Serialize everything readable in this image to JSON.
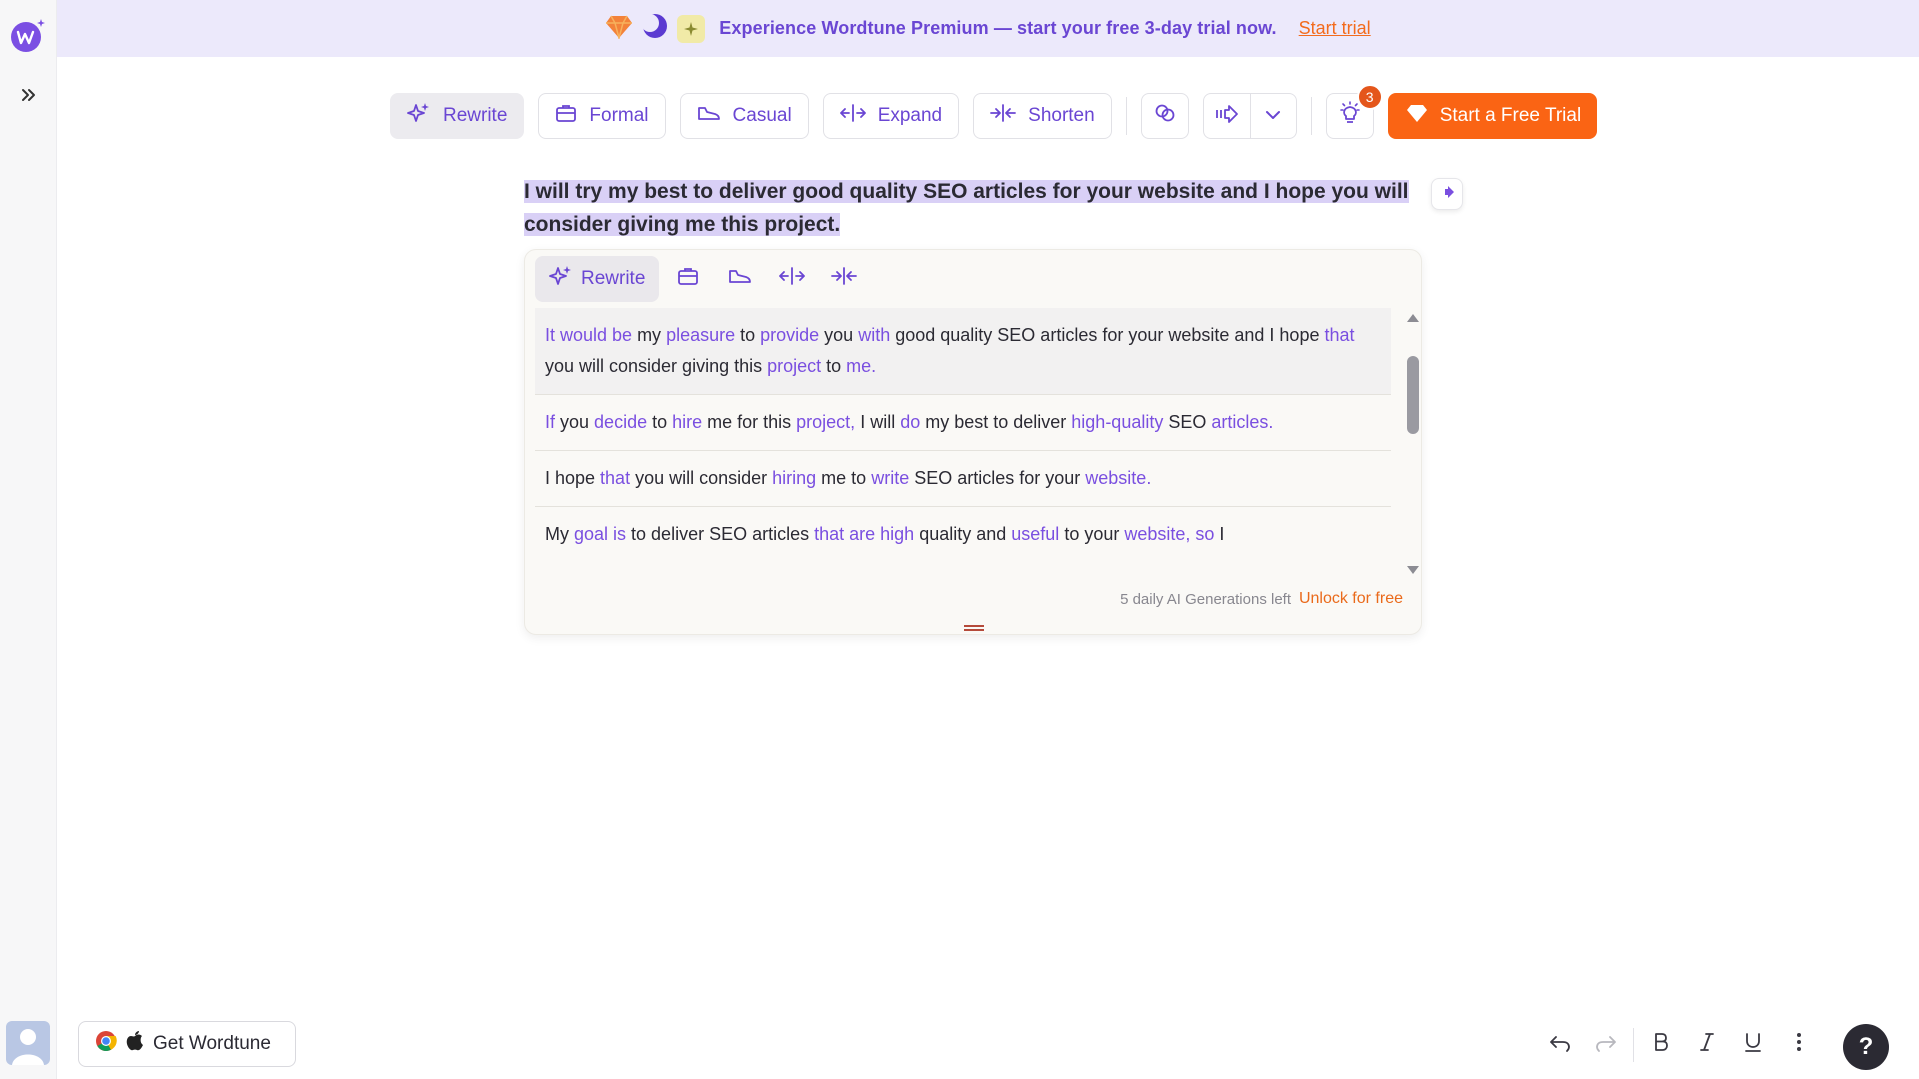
{
  "banner": {
    "text": "Experience Wordtune Premium — start your free 3-day trial now.",
    "link": "Start trial"
  },
  "toolbar": {
    "rewrite": "Rewrite",
    "formal": "Formal",
    "casual": "Casual",
    "expand": "Expand",
    "shorten": "Shorten",
    "notification_count": "3",
    "trial": "Start a Free Trial"
  },
  "editor": {
    "text": "I will try my best to deliver good quality SEO articles for your website and I hope you will consider giving me this project."
  },
  "card": {
    "rewrite_tab": "Rewrite",
    "footer": "5 daily AI Generations left",
    "unlock": "Unlock for free",
    "suggestions": [
      [
        {
          "t": "It would be",
          "c": 1
        },
        {
          "t": " my ",
          "c": 0
        },
        {
          "t": "pleasure",
          "c": 1
        },
        {
          "t": " to ",
          "c": 0
        },
        {
          "t": "provide",
          "c": 1
        },
        {
          "t": " you ",
          "c": 0
        },
        {
          "t": "with",
          "c": 1
        },
        {
          "t": " good quality SEO articles for your website and I hope ",
          "c": 0
        },
        {
          "t": "that",
          "c": 1
        },
        {
          "t": " you will consider giving this ",
          "c": 0
        },
        {
          "t": "project",
          "c": 1
        },
        {
          "t": " to ",
          "c": 0
        },
        {
          "t": "me.",
          "c": 1
        }
      ],
      [
        {
          "t": "If",
          "c": 1
        },
        {
          "t": " you ",
          "c": 0
        },
        {
          "t": "decide",
          "c": 1
        },
        {
          "t": " to ",
          "c": 0
        },
        {
          "t": "hire",
          "c": 1
        },
        {
          "t": " me for this ",
          "c": 0
        },
        {
          "t": "project,",
          "c": 1
        },
        {
          "t": " I will ",
          "c": 0
        },
        {
          "t": "do",
          "c": 1
        },
        {
          "t": " my best to deliver ",
          "c": 0
        },
        {
          "t": "high-quality",
          "c": 1
        },
        {
          "t": " SEO ",
          "c": 0
        },
        {
          "t": "articles.",
          "c": 1
        }
      ],
      [
        {
          "t": "I hope ",
          "c": 0
        },
        {
          "t": "that",
          "c": 1
        },
        {
          "t": " you will consider ",
          "c": 0
        },
        {
          "t": "hiring",
          "c": 1
        },
        {
          "t": " me to ",
          "c": 0
        },
        {
          "t": "write",
          "c": 1
        },
        {
          "t": " SEO articles for your ",
          "c": 0
        },
        {
          "t": "website.",
          "c": 1
        }
      ],
      [
        {
          "t": "My ",
          "c": 0
        },
        {
          "t": "goal is",
          "c": 1
        },
        {
          "t": " to deliver SEO articles ",
          "c": 0
        },
        {
          "t": "that are high",
          "c": 1
        },
        {
          "t": " quality and ",
          "c": 0
        },
        {
          "t": "useful",
          "c": 1
        },
        {
          "t": " to your ",
          "c": 0
        },
        {
          "t": "website, so",
          "c": 1
        },
        {
          "t": " I",
          "c": 0
        }
      ]
    ]
  },
  "bottom": {
    "get_wordtune": "Get Wordtune",
    "help": "?"
  },
  "colors": {
    "accent": "#6a46d3",
    "trial": "#fa6414",
    "banner_bg": "#ece9fb",
    "highlight": "#d9d0f6"
  }
}
